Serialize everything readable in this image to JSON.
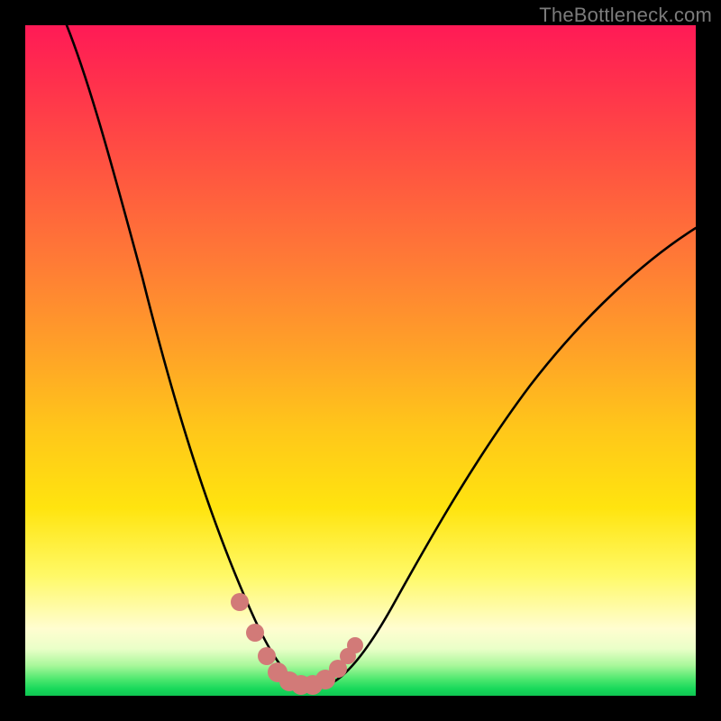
{
  "watermark": "TheBottleneck.com",
  "colors": {
    "frame": "#000000",
    "curve": "#000000",
    "marker": "#d27a78",
    "gradient_stops": [
      "#ff1a56",
      "#ff5640",
      "#ffa028",
      "#ffe40f",
      "#fffdd0",
      "#a8f79a",
      "#17d85a"
    ]
  },
  "chart_data": {
    "type": "line",
    "title": "",
    "xlabel": "",
    "ylabel": "",
    "xlim": [
      0,
      100
    ],
    "ylim": [
      0,
      100
    ],
    "note": "Axes are untitled in the image; values below are read off the plot area as fractions of 0–100 on each axis. The curve is a sharp V dipping to ~0 near x≈40 and rising steeply on both sides. Salmon markers highlight the bottom of the valley.",
    "series": [
      {
        "name": "bottleneck-curve",
        "x": [
          6,
          10,
          14,
          18,
          22,
          26,
          30,
          34,
          37,
          40,
          43,
          46,
          50,
          55,
          60,
          66,
          72,
          80,
          90,
          100
        ],
        "y": [
          100,
          86,
          72,
          58,
          45,
          33,
          22,
          12,
          5,
          0,
          4,
          10,
          18,
          27,
          35,
          43,
          50,
          57,
          63,
          68
        ]
      }
    ],
    "markers": {
      "name": "valley-highlight",
      "x": [
        31,
        34,
        36,
        38,
        40,
        42,
        44,
        46,
        48
      ],
      "y": [
        12,
        6,
        2,
        0,
        0,
        0,
        2,
        5,
        9
      ]
    }
  }
}
